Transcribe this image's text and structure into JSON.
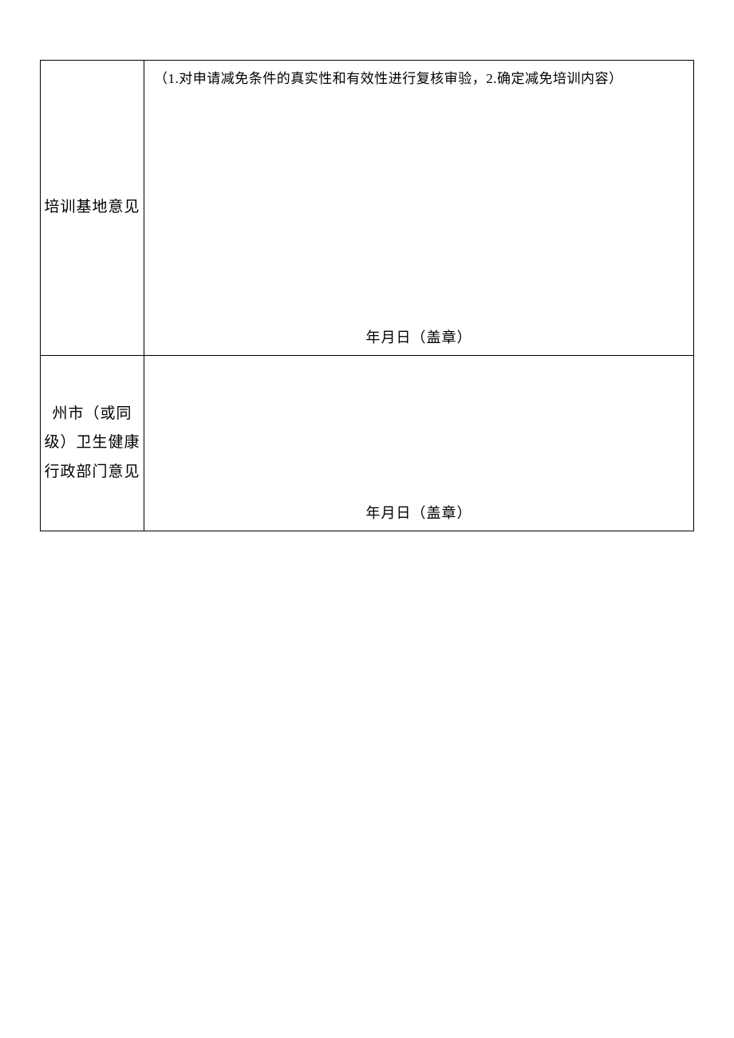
{
  "rows": [
    {
      "label": "培训基地意见",
      "note": "（1.对申请减免条件的真实性和有效性进行复核审验，2.确定减免培训内容）",
      "signature": "年月日（盖章）"
    },
    {
      "label": "州市（或同级）卫生健康行政部门意见",
      "note": "",
      "signature": "年月日（盖章）"
    }
  ]
}
